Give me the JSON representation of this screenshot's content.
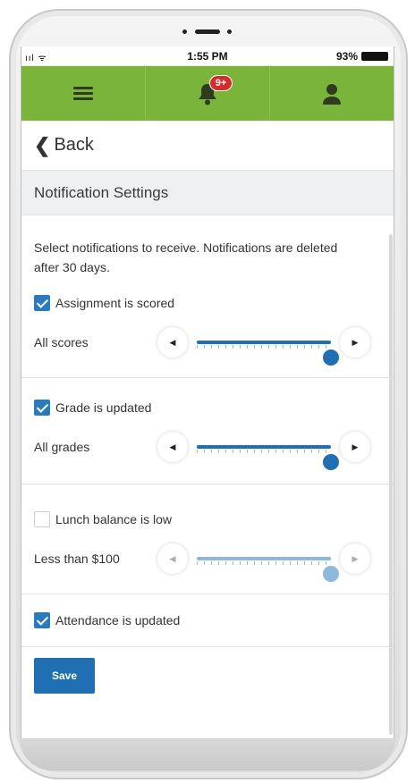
{
  "status_bar": {
    "signal": "ııl ᯤ",
    "time": "1:55 PM",
    "battery_percent": "93%"
  },
  "app_bar": {
    "notification_badge": "9+",
    "accent_color": "#7ab43b"
  },
  "nav": {
    "back_label": "Back"
  },
  "page": {
    "title": "Notification Settings",
    "intro": "Select notifications to receive. Notifications are deleted after 30 days."
  },
  "settings": [
    {
      "label": "Assignment is scored",
      "checked": true,
      "slider_label": "All scores",
      "slider_level": 1.0
    },
    {
      "label": "Grade is updated",
      "checked": true,
      "slider_label": "All grades",
      "slider_level": 1.0
    },
    {
      "label": "Lunch balance is low",
      "checked": false,
      "slider_label": "Less than $100",
      "slider_level": 1.0
    },
    {
      "label": "Attendance is updated",
      "checked": true
    }
  ],
  "actions": {
    "save_label": "Save"
  },
  "colors": {
    "primary": "#1f6fb2",
    "badge": "#d62b2b"
  }
}
